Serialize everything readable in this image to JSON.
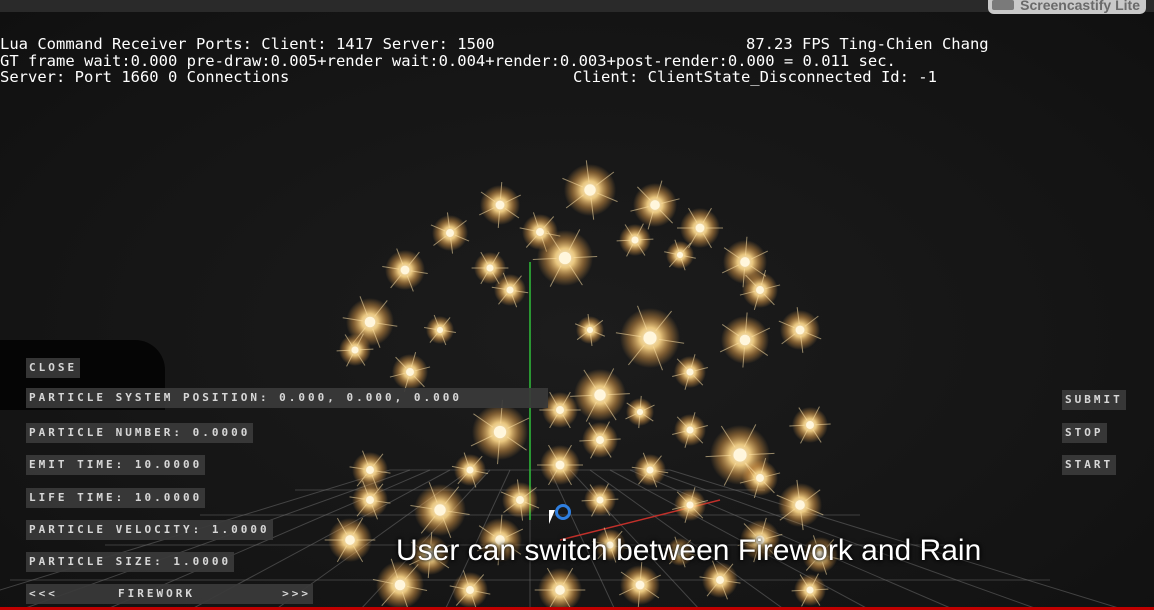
{
  "watermark": {
    "text": "Screencastify Lite"
  },
  "hud": {
    "line1": "Lua Command Receiver Ports: Client: 1417 Server: 1500",
    "fps": "87.23 FPS Ting-Chien Chang",
    "line2": "GT frame wait:0.000 pre-draw:0.005+render wait:0.004+render:0.003+post-render:0.000 = 0.011 sec.",
    "line3_left": "Server: Port 1660 0 Connections",
    "line3_right": "Client: ClientState_Disconnected Id: -1"
  },
  "panel": {
    "close_label": "CLOSE",
    "position_field": "PARTICLE SYSTEM POSITION: 0.000, 0.000, 0.000",
    "number_field": "PARTICLE NUMBER: 0.0000",
    "emit_field": "EMIT TIME: 10.0000",
    "life_field": "LIFE TIME: 10.0000",
    "velocity_field": "PARTICLE VELOCITY: 1.0000",
    "size_field": "PARTICLE SIZE: 1.0000",
    "prev_label": "<<<",
    "mode_label": "FIREWORK",
    "next_label": ">>>"
  },
  "actions": {
    "submit_label": "SUBMIT",
    "stop_label": "STOP",
    "start_label": "START"
  },
  "caption": "User can switch between Firework and Rain",
  "colors": {
    "spark_core": "#fff6dc",
    "spark_glow": "#e8a24a",
    "axis_green": "#2fbf3a",
    "axis_red": "#c0302a",
    "grid": "#6a6a6a",
    "panel_bg": "#3a3a3a"
  }
}
